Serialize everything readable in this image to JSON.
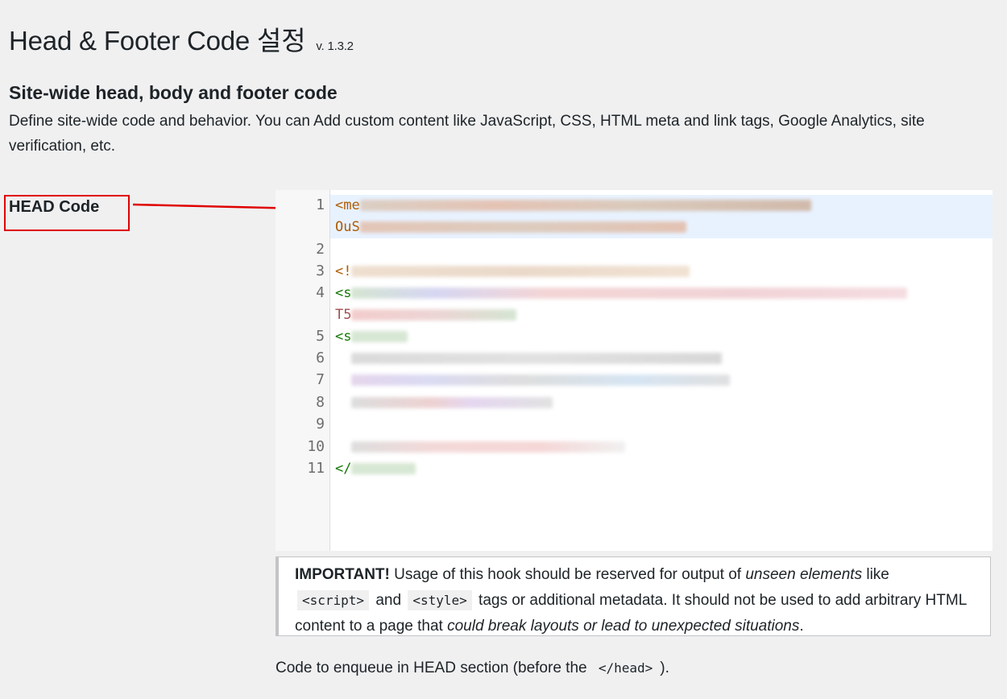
{
  "header": {
    "title": "Head & Footer Code 설정",
    "version": "v. 1.3.2"
  },
  "section": {
    "title": "Site-wide head, body and footer code",
    "description": "Define site-wide code and behavior. You can Add custom content like JavaScript, CSS, HTML meta and link tags, Google Analytics, site verification, etc."
  },
  "field": {
    "label": "HEAD Code"
  },
  "editor": {
    "line_numbers": [
      "1",
      "2",
      "3",
      "4",
      "5",
      "6",
      "7",
      "8",
      "9",
      "10",
      "11"
    ],
    "visible_code_fragments": [
      "<me",
      "OuS",
      "<!",
      "<s",
      "T5",
      "<s",
      "</"
    ],
    "active_line": "1"
  },
  "notice": {
    "strong": "IMPORTANT!",
    "text1": " Usage of this hook should be reserved for output of ",
    "em1": "unseen elements",
    "text2": " like",
    "code1": "<script>",
    "text3": " and ",
    "code2": "<style>",
    "text4": " tags or additional metadata. It should not be used to add arbitrary HTML content to a page that ",
    "em2": "could break layouts or lead to unexpected situations",
    "text5": "."
  },
  "footnote": {
    "text_before": "Code to enqueue in HEAD section (before the ",
    "code": "</head>",
    "text_after": ")."
  },
  "colors": {
    "annotation_red": "#e00000",
    "active_line_bg": "#e8f2ff",
    "page_bg": "#f0f0f1"
  }
}
